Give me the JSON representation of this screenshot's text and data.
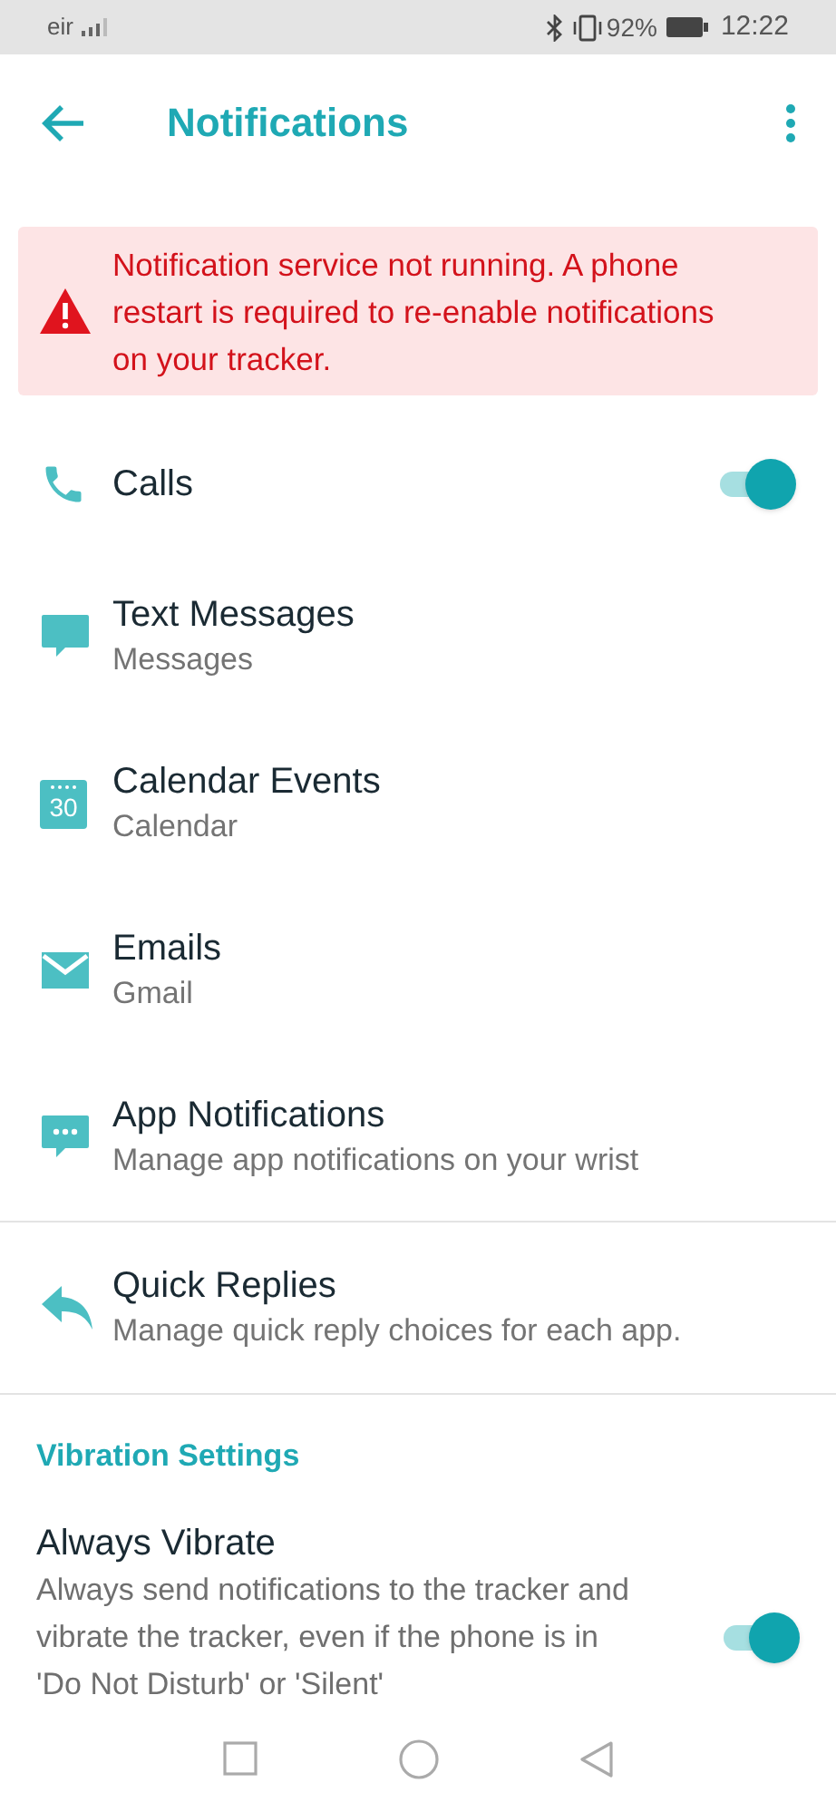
{
  "status_bar": {
    "carrier": "eir",
    "battery": "92%",
    "time": "12:22"
  },
  "header": {
    "title": "Notifications"
  },
  "alert": {
    "text": "Notification service not running. A phone restart is required to re-enable notifications on your tracker."
  },
  "items": [
    {
      "kind": "toggle",
      "title": "Calls",
      "on": true
    },
    {
      "kind": "link",
      "title": "Text Messages",
      "subtitle": "Messages"
    },
    {
      "kind": "link",
      "title": "Calendar Events",
      "subtitle": "Calendar",
      "icon_text": "30"
    },
    {
      "kind": "link",
      "title": "Emails",
      "subtitle": "Gmail"
    },
    {
      "kind": "link",
      "title": "App Notifications",
      "subtitle": "Manage app notifications on your wrist"
    },
    {
      "kind": "link",
      "title": "Quick Replies",
      "subtitle": "Manage quick reply choices for each app.",
      "divider": true
    }
  ],
  "vibration": {
    "heading": "Vibration Settings",
    "title": "Always Vibrate",
    "description": "Always send notifications to the tracker and vibrate the tracker, even if the phone is in 'Do Not Disturb' or 'Silent'",
    "on": true
  }
}
